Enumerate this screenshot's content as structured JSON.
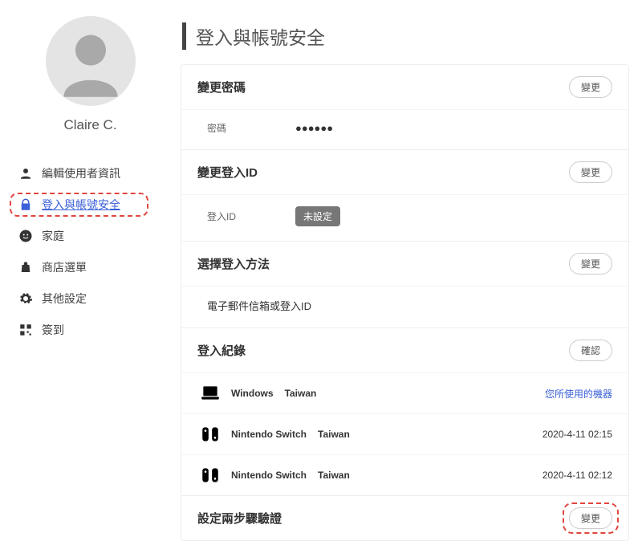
{
  "user": {
    "name": "Claire C."
  },
  "sidebar": {
    "items": [
      {
        "label": "編輯使用者資訊",
        "icon": "person"
      },
      {
        "label": "登入與帳號安全",
        "icon": "lock",
        "active": true
      },
      {
        "label": "家庭",
        "icon": "smiley"
      },
      {
        "label": "商店選單",
        "icon": "bag"
      },
      {
        "label": "其他設定",
        "icon": "gear"
      },
      {
        "label": "簽到",
        "icon": "qr"
      }
    ]
  },
  "page": {
    "title": "登入與帳號安全",
    "buttons": {
      "change": "變更",
      "confirm": "確認"
    },
    "sections": {
      "password": {
        "heading": "變更密碼",
        "row_key": "密碼",
        "row_val": "●●●●●●"
      },
      "loginId": {
        "heading": "變更登入ID",
        "row_key": "登入ID",
        "badge": "未設定"
      },
      "loginMethod": {
        "heading": "選擇登入方法",
        "row_val": "電子郵件信箱或登入ID"
      },
      "history": {
        "heading": "登入紀錄",
        "current_label": "您所使用的機器",
        "items": [
          {
            "device": "Windows",
            "location": "Taiwan",
            "right": "current",
            "icon": "laptop"
          },
          {
            "device": "Nintendo Switch",
            "location": "Taiwan",
            "right": "2020-4-11 02:15",
            "icon": "switch"
          },
          {
            "device": "Nintendo Switch",
            "location": "Taiwan",
            "right": "2020-4-11 02:12",
            "icon": "switch"
          }
        ]
      },
      "twofa": {
        "heading": "設定兩步驟驗證"
      }
    }
  }
}
